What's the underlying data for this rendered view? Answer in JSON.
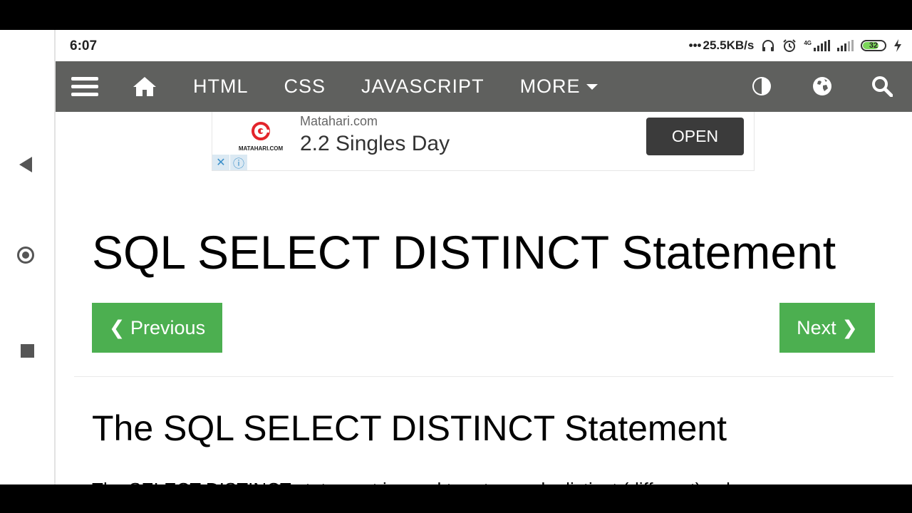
{
  "status_bar": {
    "time": "6:07",
    "network_speed": "25.5KB/s",
    "network_type": "4G",
    "battery_level": "32",
    "icons": [
      "headphones-icon",
      "alarm-icon",
      "signal-icon",
      "battery-icon",
      "charging-icon"
    ]
  },
  "topnav": {
    "menu_icon": "hamburger-icon",
    "home_icon": "home-icon",
    "links": [
      "HTML",
      "CSS",
      "JAVASCRIPT",
      "MORE"
    ],
    "right_icons": [
      "contrast-icon",
      "globe-icon",
      "search-icon"
    ],
    "background": "#5f605e"
  },
  "ad": {
    "brand": "MATAHARI.COM",
    "site": "Matahari.com",
    "headline": "2.2 Singles Day",
    "cta": "OPEN",
    "controls": [
      "close-ad-icon",
      "ad-info-icon"
    ]
  },
  "page": {
    "title": "SQL SELECT DISTINCT Statement",
    "prev_label": "❮ Previous",
    "next_label": "Next ❯",
    "section_title": "The SQL SELECT DISTINCT Statement",
    "paragraph": "The SELECT DISTINCT statement is used to return only distinct (different) values.",
    "accent": "#4caf50"
  }
}
